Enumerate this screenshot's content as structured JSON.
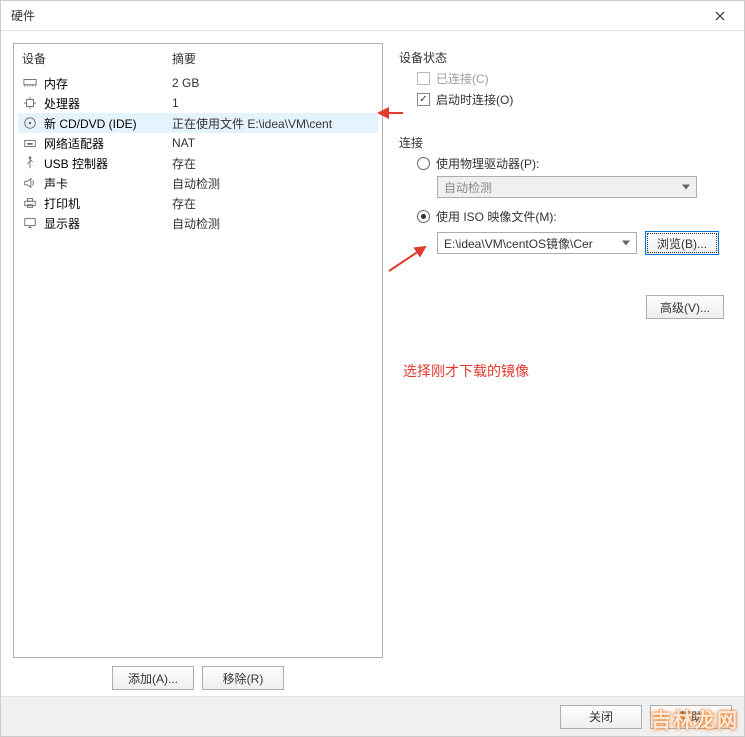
{
  "window": {
    "title": "硬件",
    "close_icon": "close"
  },
  "devices": {
    "col_device": "设备",
    "col_summary": "摘要",
    "rows": [
      {
        "icon": "memory",
        "label": "内存",
        "summary": "2 GB",
        "selected": false
      },
      {
        "icon": "cpu",
        "label": "处理器",
        "summary": "1",
        "selected": false
      },
      {
        "icon": "cd",
        "label": "新 CD/DVD (IDE)",
        "summary": "正在使用文件 E:\\idea\\VM\\cent",
        "selected": true
      },
      {
        "icon": "network",
        "label": "网络适配器",
        "summary": "NAT",
        "selected": false
      },
      {
        "icon": "usb",
        "label": "USB 控制器",
        "summary": "存在",
        "selected": false
      },
      {
        "icon": "sound",
        "label": "声卡",
        "summary": "自动检测",
        "selected": false
      },
      {
        "icon": "printer",
        "label": "打印机",
        "summary": "存在",
        "selected": false
      },
      {
        "icon": "display",
        "label": "显示器",
        "summary": "自动检测",
        "selected": false
      }
    ],
    "add": "添加(A)...",
    "remove": "移除(R)"
  },
  "device_status": {
    "title": "设备状态",
    "connected": "已连接(C)",
    "connect_at_power": "启动时连接(O)"
  },
  "connection": {
    "title": "连接",
    "physical_drive": "使用物理驱动器(P):",
    "physical_dropdown": "自动检测",
    "iso_file": "使用 ISO 映像文件(M):",
    "iso_path": "E:\\idea\\VM\\centOS镜像\\Cer",
    "browse": "浏览(B)..."
  },
  "advanced": "高级(V)...",
  "annotation": "选择刚才下载的镜像",
  "footer": {
    "close": "关闭",
    "help": "帮助"
  },
  "watermark": "吉林龙网"
}
